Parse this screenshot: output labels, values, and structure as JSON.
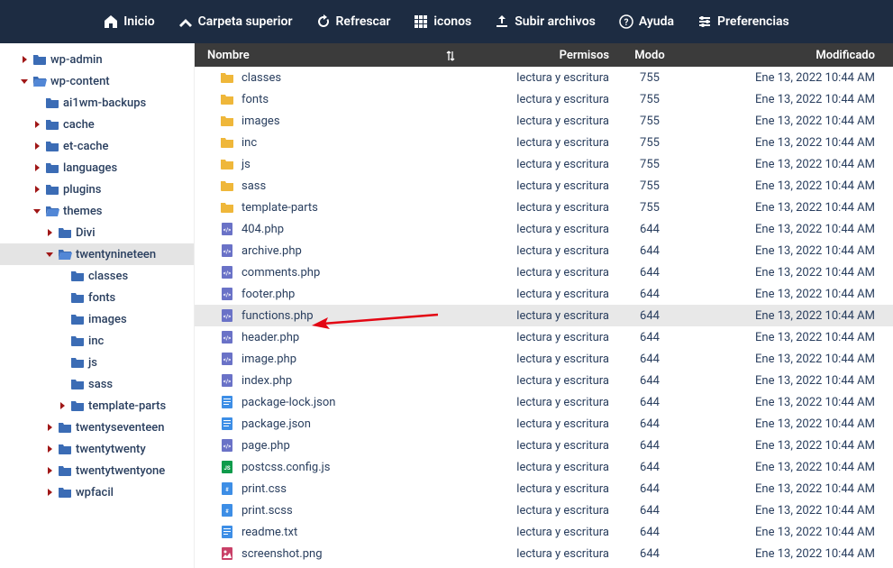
{
  "topbar": [
    {
      "icon": "home",
      "label": "Inicio"
    },
    {
      "icon": "up",
      "label": "Carpeta superior"
    },
    {
      "icon": "refresh",
      "label": "Refrescar"
    },
    {
      "icon": "grid",
      "label": "iconos"
    },
    {
      "icon": "upload",
      "label": "Subir archivos"
    },
    {
      "icon": "help",
      "label": "Ayuda"
    },
    {
      "icon": "prefs",
      "label": "Preferencias"
    }
  ],
  "tree": [
    {
      "indent": 1,
      "caret": "right",
      "open": false,
      "label": "wp-admin"
    },
    {
      "indent": 1,
      "caret": "down",
      "open": true,
      "label": "wp-content"
    },
    {
      "indent": 2,
      "caret": "blank",
      "open": false,
      "label": "ai1wm-backups"
    },
    {
      "indent": 2,
      "caret": "right",
      "open": false,
      "label": "cache"
    },
    {
      "indent": 2,
      "caret": "right",
      "open": false,
      "label": "et-cache"
    },
    {
      "indent": 2,
      "caret": "right",
      "open": false,
      "label": "languages"
    },
    {
      "indent": 2,
      "caret": "right",
      "open": false,
      "label": "plugins"
    },
    {
      "indent": 2,
      "caret": "down",
      "open": true,
      "label": "themes"
    },
    {
      "indent": 3,
      "caret": "right",
      "open": false,
      "label": "Divi"
    },
    {
      "indent": 3,
      "caret": "down",
      "open": true,
      "label": "twentynineteen",
      "selected": true
    },
    {
      "indent": 4,
      "caret": "blank",
      "open": false,
      "label": "classes"
    },
    {
      "indent": 4,
      "caret": "blank",
      "open": false,
      "label": "fonts"
    },
    {
      "indent": 4,
      "caret": "blank",
      "open": false,
      "label": "images"
    },
    {
      "indent": 4,
      "caret": "blank",
      "open": false,
      "label": "inc"
    },
    {
      "indent": 4,
      "caret": "blank",
      "open": false,
      "label": "js"
    },
    {
      "indent": 4,
      "caret": "blank",
      "open": false,
      "label": "sass"
    },
    {
      "indent": 4,
      "caret": "right",
      "open": false,
      "label": "template-parts"
    },
    {
      "indent": 3,
      "caret": "right",
      "open": false,
      "label": "twentyseventeen"
    },
    {
      "indent": 3,
      "caret": "right",
      "open": false,
      "label": "twentytwenty"
    },
    {
      "indent": 3,
      "caret": "right",
      "open": false,
      "label": "twentytwentyone"
    },
    {
      "indent": 3,
      "caret": "right",
      "open": false,
      "label": "wpfacil"
    }
  ],
  "columns": {
    "name": "Nombre",
    "perm": "Permisos",
    "mode": "Modo",
    "mod": "Modificado"
  },
  "files": [
    {
      "type": "folder",
      "name": "classes",
      "perm": "lectura y escritura",
      "mode": "755",
      "mod": "Ene 13, 2022 10:44 AM"
    },
    {
      "type": "folder",
      "name": "fonts",
      "perm": "lectura y escritura",
      "mode": "755",
      "mod": "Ene 13, 2022 10:44 AM"
    },
    {
      "type": "folder",
      "name": "images",
      "perm": "lectura y escritura",
      "mode": "755",
      "mod": "Ene 13, 2022 10:44 AM"
    },
    {
      "type": "folder",
      "name": "inc",
      "perm": "lectura y escritura",
      "mode": "755",
      "mod": "Ene 13, 2022 10:44 AM"
    },
    {
      "type": "folder",
      "name": "js",
      "perm": "lectura y escritura",
      "mode": "755",
      "mod": "Ene 13, 2022 10:44 AM"
    },
    {
      "type": "folder",
      "name": "sass",
      "perm": "lectura y escritura",
      "mode": "755",
      "mod": "Ene 13, 2022 10:44 AM"
    },
    {
      "type": "folder",
      "name": "template-parts",
      "perm": "lectura y escritura",
      "mode": "755",
      "mod": "Ene 13, 2022 10:44 AM"
    },
    {
      "type": "php",
      "name": "404.php",
      "perm": "lectura y escritura",
      "mode": "644",
      "mod": "Ene 13, 2022 10:44 AM"
    },
    {
      "type": "php",
      "name": "archive.php",
      "perm": "lectura y escritura",
      "mode": "644",
      "mod": "Ene 13, 2022 10:44 AM"
    },
    {
      "type": "php",
      "name": "comments.php",
      "perm": "lectura y escritura",
      "mode": "644",
      "mod": "Ene 13, 2022 10:44 AM"
    },
    {
      "type": "php",
      "name": "footer.php",
      "perm": "lectura y escritura",
      "mode": "644",
      "mod": "Ene 13, 2022 10:44 AM"
    },
    {
      "type": "php",
      "name": "functions.php",
      "perm": "lectura y escritura",
      "mode": "644",
      "mod": "Ene 13, 2022 10:44 AM",
      "highlight": true
    },
    {
      "type": "php",
      "name": "header.php",
      "perm": "lectura y escritura",
      "mode": "644",
      "mod": "Ene 13, 2022 10:44 AM"
    },
    {
      "type": "php",
      "name": "image.php",
      "perm": "lectura y escritura",
      "mode": "644",
      "mod": "Ene 13, 2022 10:44 AM"
    },
    {
      "type": "php",
      "name": "index.php",
      "perm": "lectura y escritura",
      "mode": "644",
      "mod": "Ene 13, 2022 10:44 AM"
    },
    {
      "type": "json",
      "name": "package-lock.json",
      "perm": "lectura y escritura",
      "mode": "644",
      "mod": "Ene 13, 2022 10:44 AM"
    },
    {
      "type": "json",
      "name": "package.json",
      "perm": "lectura y escritura",
      "mode": "644",
      "mod": "Ene 13, 2022 10:44 AM"
    },
    {
      "type": "php",
      "name": "page.php",
      "perm": "lectura y escritura",
      "mode": "644",
      "mod": "Ene 13, 2022 10:44 AM"
    },
    {
      "type": "js",
      "name": "postcss.config.js",
      "perm": "lectura y escritura",
      "mode": "644",
      "mod": "Ene 13, 2022 10:44 AM"
    },
    {
      "type": "css",
      "name": "print.css",
      "perm": "lectura y escritura",
      "mode": "644",
      "mod": "Ene 13, 2022 10:44 AM"
    },
    {
      "type": "css",
      "name": "print.scss",
      "perm": "lectura y escritura",
      "mode": "644",
      "mod": "Ene 13, 2022 10:44 AM"
    },
    {
      "type": "txt",
      "name": "readme.txt",
      "perm": "lectura y escritura",
      "mode": "644",
      "mod": "Ene 13, 2022 10:44 AM"
    },
    {
      "type": "img",
      "name": "screenshot.png",
      "perm": "lectura y escritura",
      "mode": "644",
      "mod": "Ene 13, 2022 10:44 AM"
    }
  ]
}
